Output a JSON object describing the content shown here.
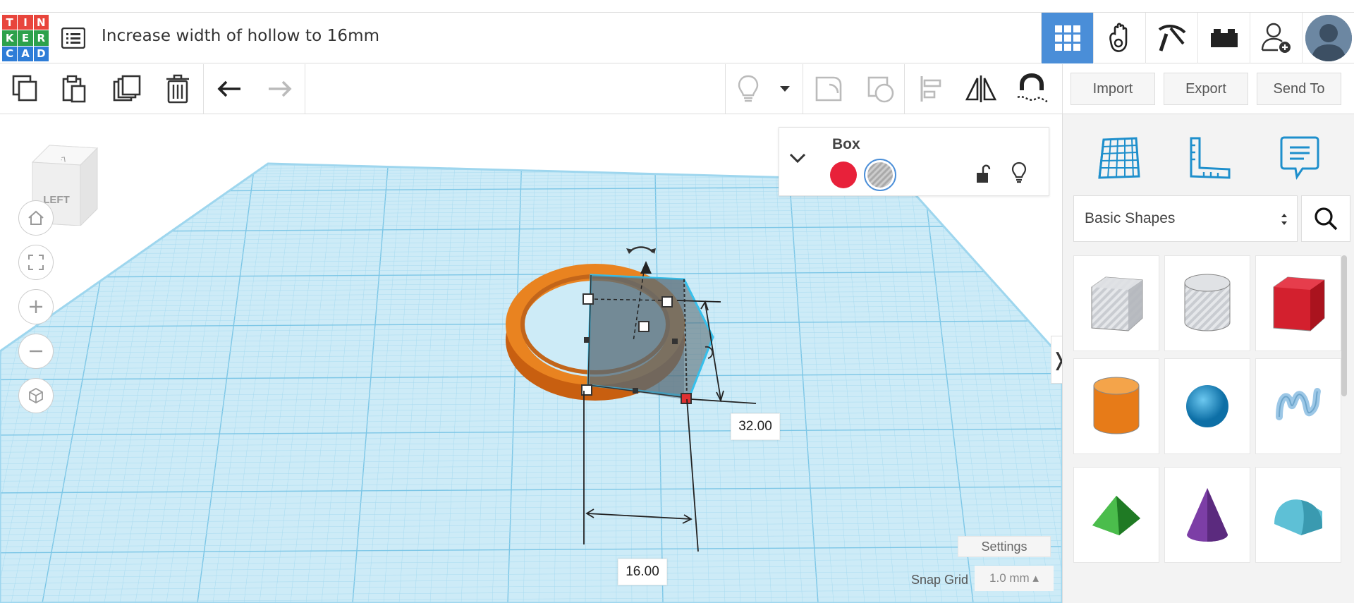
{
  "header": {
    "logo_letters": [
      "T",
      "I",
      "N",
      "K",
      "E",
      "R",
      "C",
      "A",
      "D"
    ],
    "logo_colors": [
      "#e8453c",
      "#e8453c",
      "#e8453c",
      "#2da14b",
      "#2da14b",
      "#2da14b",
      "#2e7dd7",
      "#2e7dd7",
      "#2e7dd7"
    ],
    "title": "Increase width of hollow to 16mm",
    "icons": [
      "grid-icon",
      "gallery-hand-icon",
      "pickaxe-icon",
      "bricks-icon",
      "add-user-icon"
    ],
    "accent": "#4a8ed8"
  },
  "toolbar": {
    "import_label": "Import",
    "export_label": "Export",
    "send_to_label": "Send To"
  },
  "viewcube": {
    "face_label": "LEFT"
  },
  "inspector": {
    "title": "Box",
    "solid_color": "#e8213a"
  },
  "dimensions": {
    "height": "32.00",
    "width": "16.00"
  },
  "viewport": {
    "settings_label": "Settings",
    "snap_grid_label": "Snap Grid",
    "snap_grid_value": "1.0 mm ▴",
    "collapse_toggle": "❭"
  },
  "panel": {
    "category": "Basic Shapes",
    "tabs": [
      "workplane-icon",
      "ruler-icon",
      "notes-icon"
    ],
    "shapes": [
      {
        "name": "box-hole",
        "color": "#bfc3c9"
      },
      {
        "name": "cylinder-hole",
        "color": "#c6c9ce"
      },
      {
        "name": "box",
        "color": "#d3202e"
      },
      {
        "name": "cylinder",
        "color": "#e77b18"
      },
      {
        "name": "sphere",
        "color": "#1b8fc8"
      },
      {
        "name": "scribble",
        "color": "#9cc7e6"
      },
      {
        "name": "roof",
        "color": "#3aa33b"
      },
      {
        "name": "cone",
        "color": "#7c3ea6"
      },
      {
        "name": "round-roof",
        "color": "#5ec0d6"
      }
    ]
  }
}
